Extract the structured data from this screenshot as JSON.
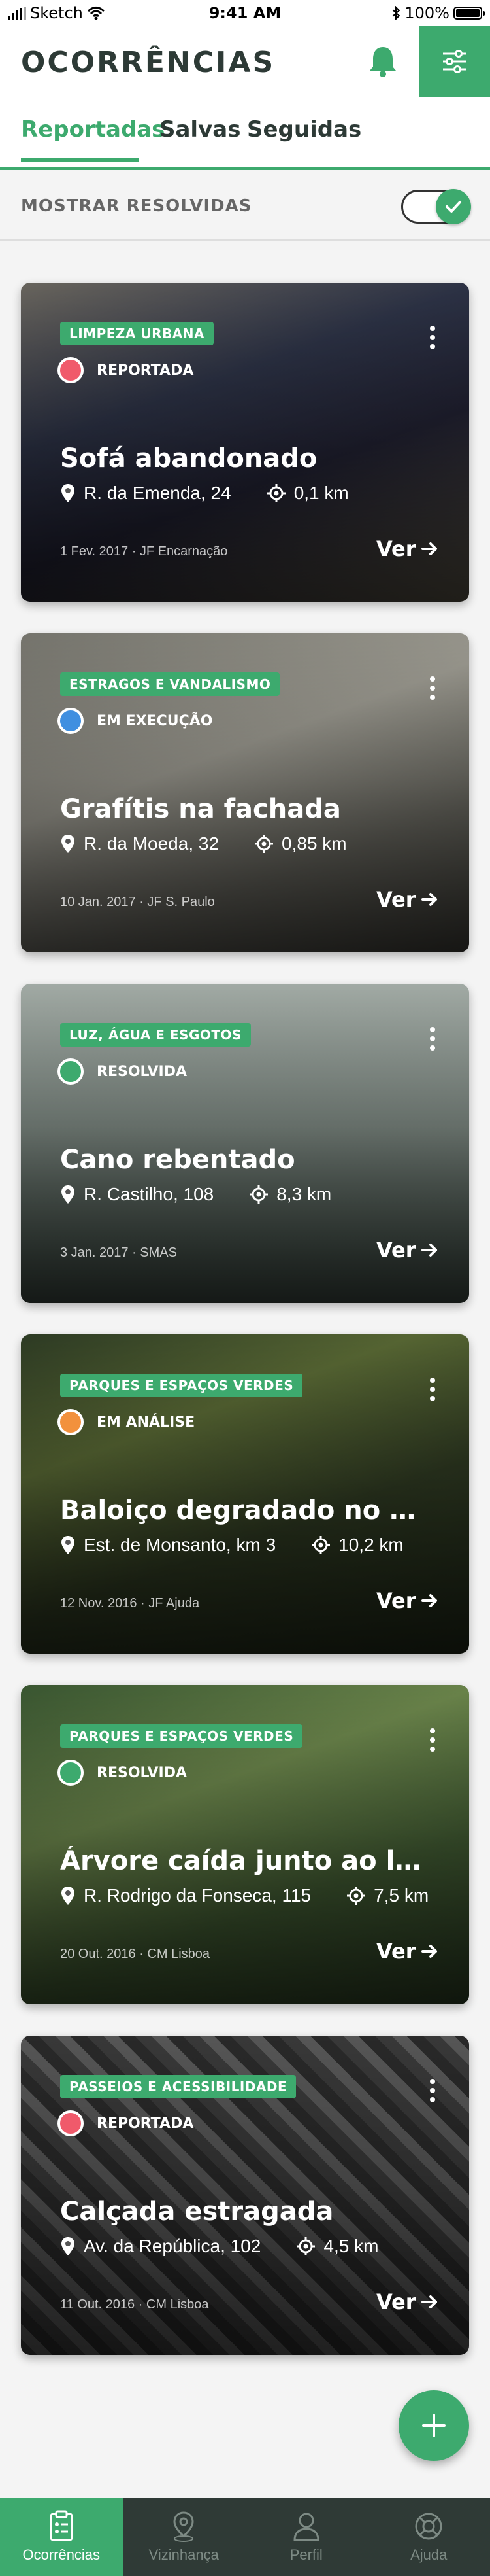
{
  "status_bar": {
    "carrier": "Sketch",
    "time": "9:41 AM",
    "battery": "100%",
    "battery_level": 1.0
  },
  "header": {
    "title": "OCORRÊNCIAS"
  },
  "tabs": [
    {
      "label": "Reportadas",
      "active": true
    },
    {
      "label": "Salvas",
      "active": false
    },
    {
      "label": "Seguidas",
      "active": false
    }
  ],
  "filter": {
    "label": "MOSTRAR RESOLVIDAS",
    "enabled": true
  },
  "view_label": "Ver",
  "colors": {
    "accent": "#3daa6e",
    "status_reportada": "#f05a6b",
    "status_execucao": "#3f8fe0",
    "status_resolvida": "#3daa6e",
    "status_analise": "#f2913d",
    "nav_bg": "#2f3a36"
  },
  "cards": [
    {
      "category": "LIMPEZA URBANA",
      "status": "REPORTADA",
      "status_color": "#f05a6b",
      "title": "Sofá abandonado",
      "address": "R. da Emenda, 24",
      "distance": "0,1 km",
      "date": "1 Fev. 2017 · JF Encarnação"
    },
    {
      "category": "ESTRAGOS E VANDALISMO",
      "status": "EM EXECUÇÃO",
      "status_color": "#3f8fe0",
      "title": "Grafítis na fachada",
      "address": "R. da Moeda, 32",
      "distance": "0,85 km",
      "date": "10 Jan. 2017 · JF S. Paulo"
    },
    {
      "category": "LUZ, ÁGUA E ESGOTOS",
      "status": "RESOLVIDA",
      "status_color": "#3daa6e",
      "title": "Cano rebentado",
      "address": "R. Castilho, 108",
      "distance": "8,3 km",
      "date": "3 Jan. 2017 · SMAS"
    },
    {
      "category": "PARQUES E ESPAÇOS VERDES",
      "status": "EM ANÁLISE",
      "status_color": "#f2913d",
      "title": "Baloiço degradado no par...",
      "address": "Est. de Monsanto, km 3",
      "distance": "10,2 km",
      "date": "12 Nov. 2016 · JF Ajuda"
    },
    {
      "category": "PARQUES E ESPAÇOS VERDES",
      "status": "RESOLVIDA",
      "status_color": "#3daa6e",
      "title": "Árvore caída junto ao lice...",
      "address": "R. Rodrigo da Fonseca, 115",
      "distance": "7,5 km",
      "date": "20 Out. 2016 · CM Lisboa"
    },
    {
      "category": "PASSEIOS E ACESSIBILIDADE",
      "status": "REPORTADA",
      "status_color": "#f05a6b",
      "title": "Calçada estragada",
      "address": "Av. da República, 102",
      "distance": "4,5 km",
      "date": "11 Out. 2016 · CM Lisboa"
    }
  ],
  "bottom_nav": [
    {
      "label": "Ocorrências",
      "icon": "clipboard-icon",
      "active": true
    },
    {
      "label": "Vizinhança",
      "icon": "map-pin-icon",
      "active": false
    },
    {
      "label": "Perfil",
      "icon": "user-icon",
      "active": false
    },
    {
      "label": "Ajuda",
      "icon": "lifebuoy-icon",
      "active": false
    }
  ]
}
